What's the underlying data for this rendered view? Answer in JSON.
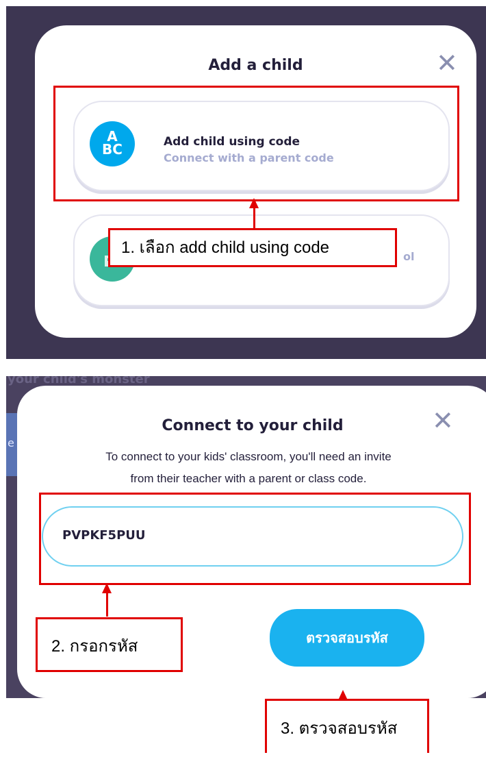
{
  "add_child_dialog": {
    "title": "Add a child",
    "close_glyph": "✕",
    "option_code": {
      "icon_text_line1": "A",
      "icon_text_line2": "BC",
      "title": "Add child using code",
      "subtitle": "Connect with a parent code",
      "icon_color": "#00a8ec"
    },
    "option_school": {
      "partial_text": "ol",
      "icon_color": "#3ab79b"
    }
  },
  "connect_dialog": {
    "title": "Connect to your child",
    "close_glyph": "✕",
    "description_line1": "To connect to  your kids' classroom, you'll need an invite",
    "description_line2": "from their teacher with a parent or class code.",
    "code_input_value": "PVPKF5PUU",
    "verify_button_label": "ตรวจสอบรหัส",
    "background_partial_text": "your child's monster",
    "background_partial_letter": "e"
  },
  "annotations": {
    "step1": "1. เลือก add child using code",
    "step2": "2. กรอกรหัส",
    "step3": "3. ตรวจสอบรหัส",
    "color": "#e00000"
  }
}
